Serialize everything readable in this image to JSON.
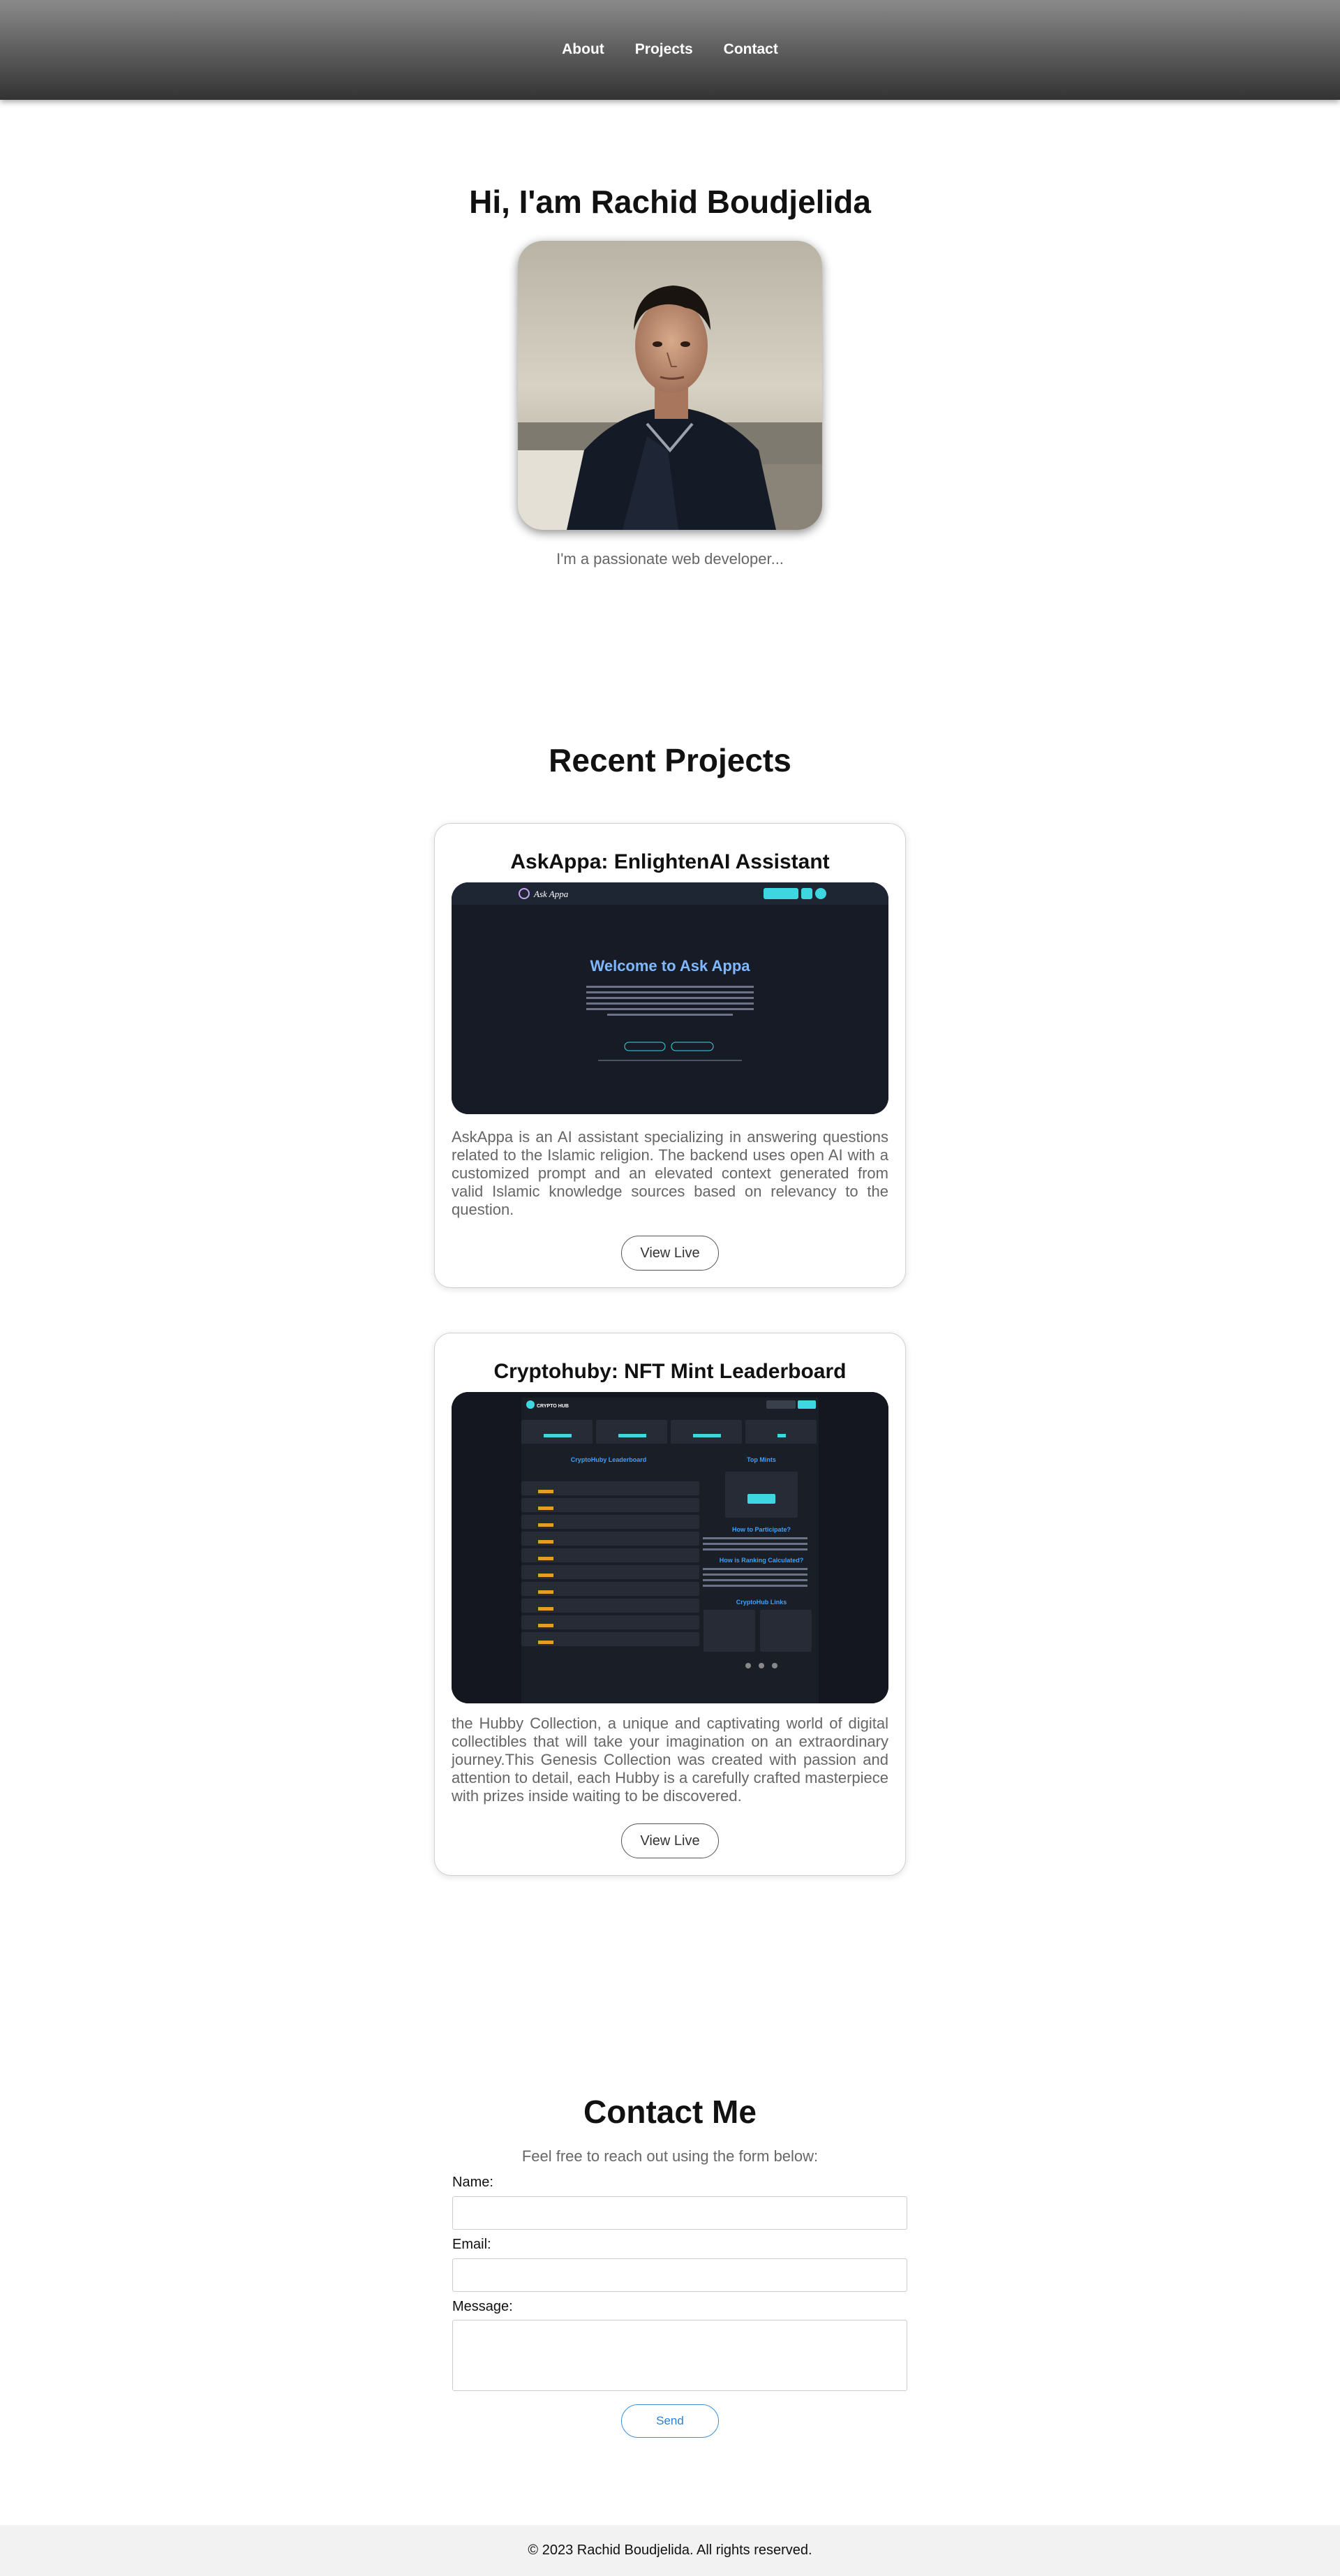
{
  "nav": {
    "items": [
      {
        "label": "About"
      },
      {
        "label": "Projects"
      },
      {
        "label": "Contact"
      }
    ]
  },
  "hero": {
    "title": "Hi, I'am Rachid Boudjelida",
    "subtitle": "I'm a passionate web developer...",
    "avatar_icon": "portrait-photo"
  },
  "projects": {
    "title": "Recent Projects",
    "items": [
      {
        "title": "AskAppa: EnlightenAI Assistant",
        "description": "AskAppa is an AI assistant specializing in answering questions related to the Islamic religion. The backend uses open AI with a customized prompt and an elevated context generated from valid Islamic knowledge sources based on relevancy to the question.",
        "button_label": "View Live",
        "screenshot": {
          "logo": "Ask Appa",
          "heading": "Welcome to Ask Appa",
          "heading_color": "#7fb8ff",
          "accent": "#3ed6e0"
        }
      },
      {
        "title": "Cryptohuby: NFT Mint Leaderboard",
        "description": "the Hubby Collection, a unique and captivating world of digital collectibles that will take your imagination on an extraordinary journey.This Genesis Collection was created with passion and attention to detail, each Hubby is a carefully crafted masterpiece with prizes inside waiting to be discovered.",
        "button_label": "View Live",
        "screenshot": {
          "logo": "CRYPTO HUB",
          "leaderboard_title": "CryptoHuby Leaderboard",
          "top_mints": "Top Mints",
          "how_to": "How to Participate?",
          "ranking": "How is Ranking Calculated?",
          "links": "CryptoHub Links",
          "accent": "#3ed6e0",
          "badge_color": "#e0a020"
        }
      }
    ]
  },
  "contact": {
    "title": "Contact Me",
    "subtitle": "Feel free to reach out using the form below:",
    "name_label": "Name:",
    "email_label": "Email:",
    "message_label": "Message:",
    "send_label": "Send"
  },
  "footer": {
    "text": "© 2023 Rachid Boudjelida. All rights reserved."
  }
}
